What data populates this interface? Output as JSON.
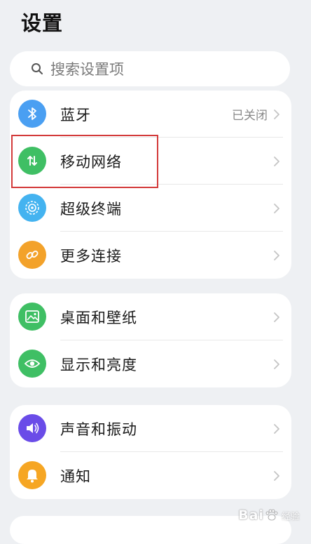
{
  "page": {
    "title": "设置"
  },
  "search": {
    "placeholder": "搜索设置项",
    "icon": "search-icon"
  },
  "groups": [
    {
      "items": [
        {
          "label": "蓝牙",
          "value": "已关闭",
          "icon": "bluetooth-icon",
          "color": "#4a9ff2"
        },
        {
          "label": "移动网络",
          "value": "",
          "icon": "mobile-network-icon",
          "color": "#3fbf64",
          "highlighted": true
        },
        {
          "label": "超级终端",
          "value": "",
          "icon": "super-device-icon",
          "color": "#44b3f0"
        },
        {
          "label": "更多连接",
          "value": "",
          "icon": "link-icon",
          "color": "#f3a22a"
        }
      ]
    },
    {
      "items": [
        {
          "label": "桌面和壁纸",
          "value": "",
          "icon": "wallpaper-icon",
          "color": "#3fbf64"
        },
        {
          "label": "显示和亮度",
          "value": "",
          "icon": "eye-icon",
          "color": "#3fbf64"
        }
      ]
    },
    {
      "items": [
        {
          "label": "声音和振动",
          "value": "",
          "icon": "speaker-icon",
          "color": "#6a4ce8"
        },
        {
          "label": "通知",
          "value": "",
          "icon": "bell-icon",
          "color": "#f6a623"
        }
      ]
    }
  ],
  "watermark": {
    "text": "Bai",
    "sub": "经验"
  }
}
